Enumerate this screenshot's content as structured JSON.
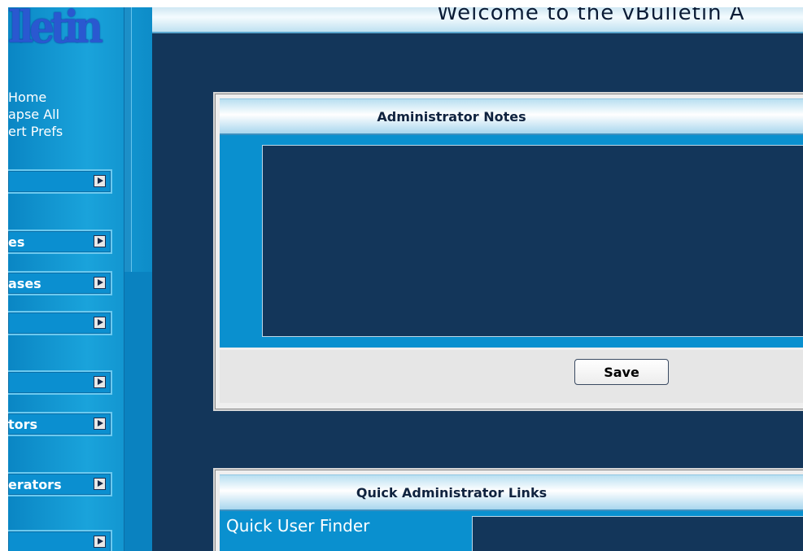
{
  "sidebar": {
    "logo_fragment": "lletin",
    "top_links": [
      "Home",
      "apse All",
      "ert Prefs"
    ],
    "nav_items": [
      {
        "label": ""
      },
      {
        "label": "es"
      },
      {
        "label": "ases"
      },
      {
        "label": ""
      },
      {
        "label": ""
      },
      {
        "label": "tors"
      },
      {
        "label": "erators"
      },
      {
        "label": ""
      }
    ]
  },
  "header": {
    "welcome": "Welcome to the vBulletin A"
  },
  "notes_panel": {
    "title": "Administrator Notes",
    "notes_value": "",
    "save_label": "Save"
  },
  "links_panel": {
    "title": "Quick Administrator Links",
    "user_finder_label": "Quick User Finder",
    "user_finder_value": ""
  },
  "colors": {
    "page_bg": "#13365a",
    "sidebar_bg": "#0a86c4",
    "panel_bg": "#efefef",
    "panel_body": "#0a90cf"
  }
}
